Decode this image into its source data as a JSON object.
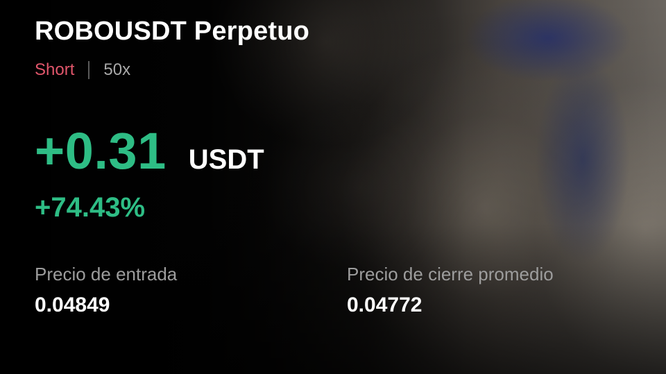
{
  "position": {
    "title": "ROBOUSDT Perpetuo",
    "side": "Short",
    "leverage": "50x"
  },
  "pnl": {
    "value": "+0.31",
    "unit": "USDT",
    "percent": "+74.43%"
  },
  "stats": {
    "entry_price_label": "Precio de entrada",
    "entry_price_value": "0.04849",
    "close_price_label": "Precio de cierre promedio",
    "close_price_value": "0.04772"
  },
  "colors": {
    "profit_green": "#2ebd85",
    "short_red": "#e0566b",
    "muted_gray": "#9d9d9d",
    "text_white": "#ffffff"
  }
}
